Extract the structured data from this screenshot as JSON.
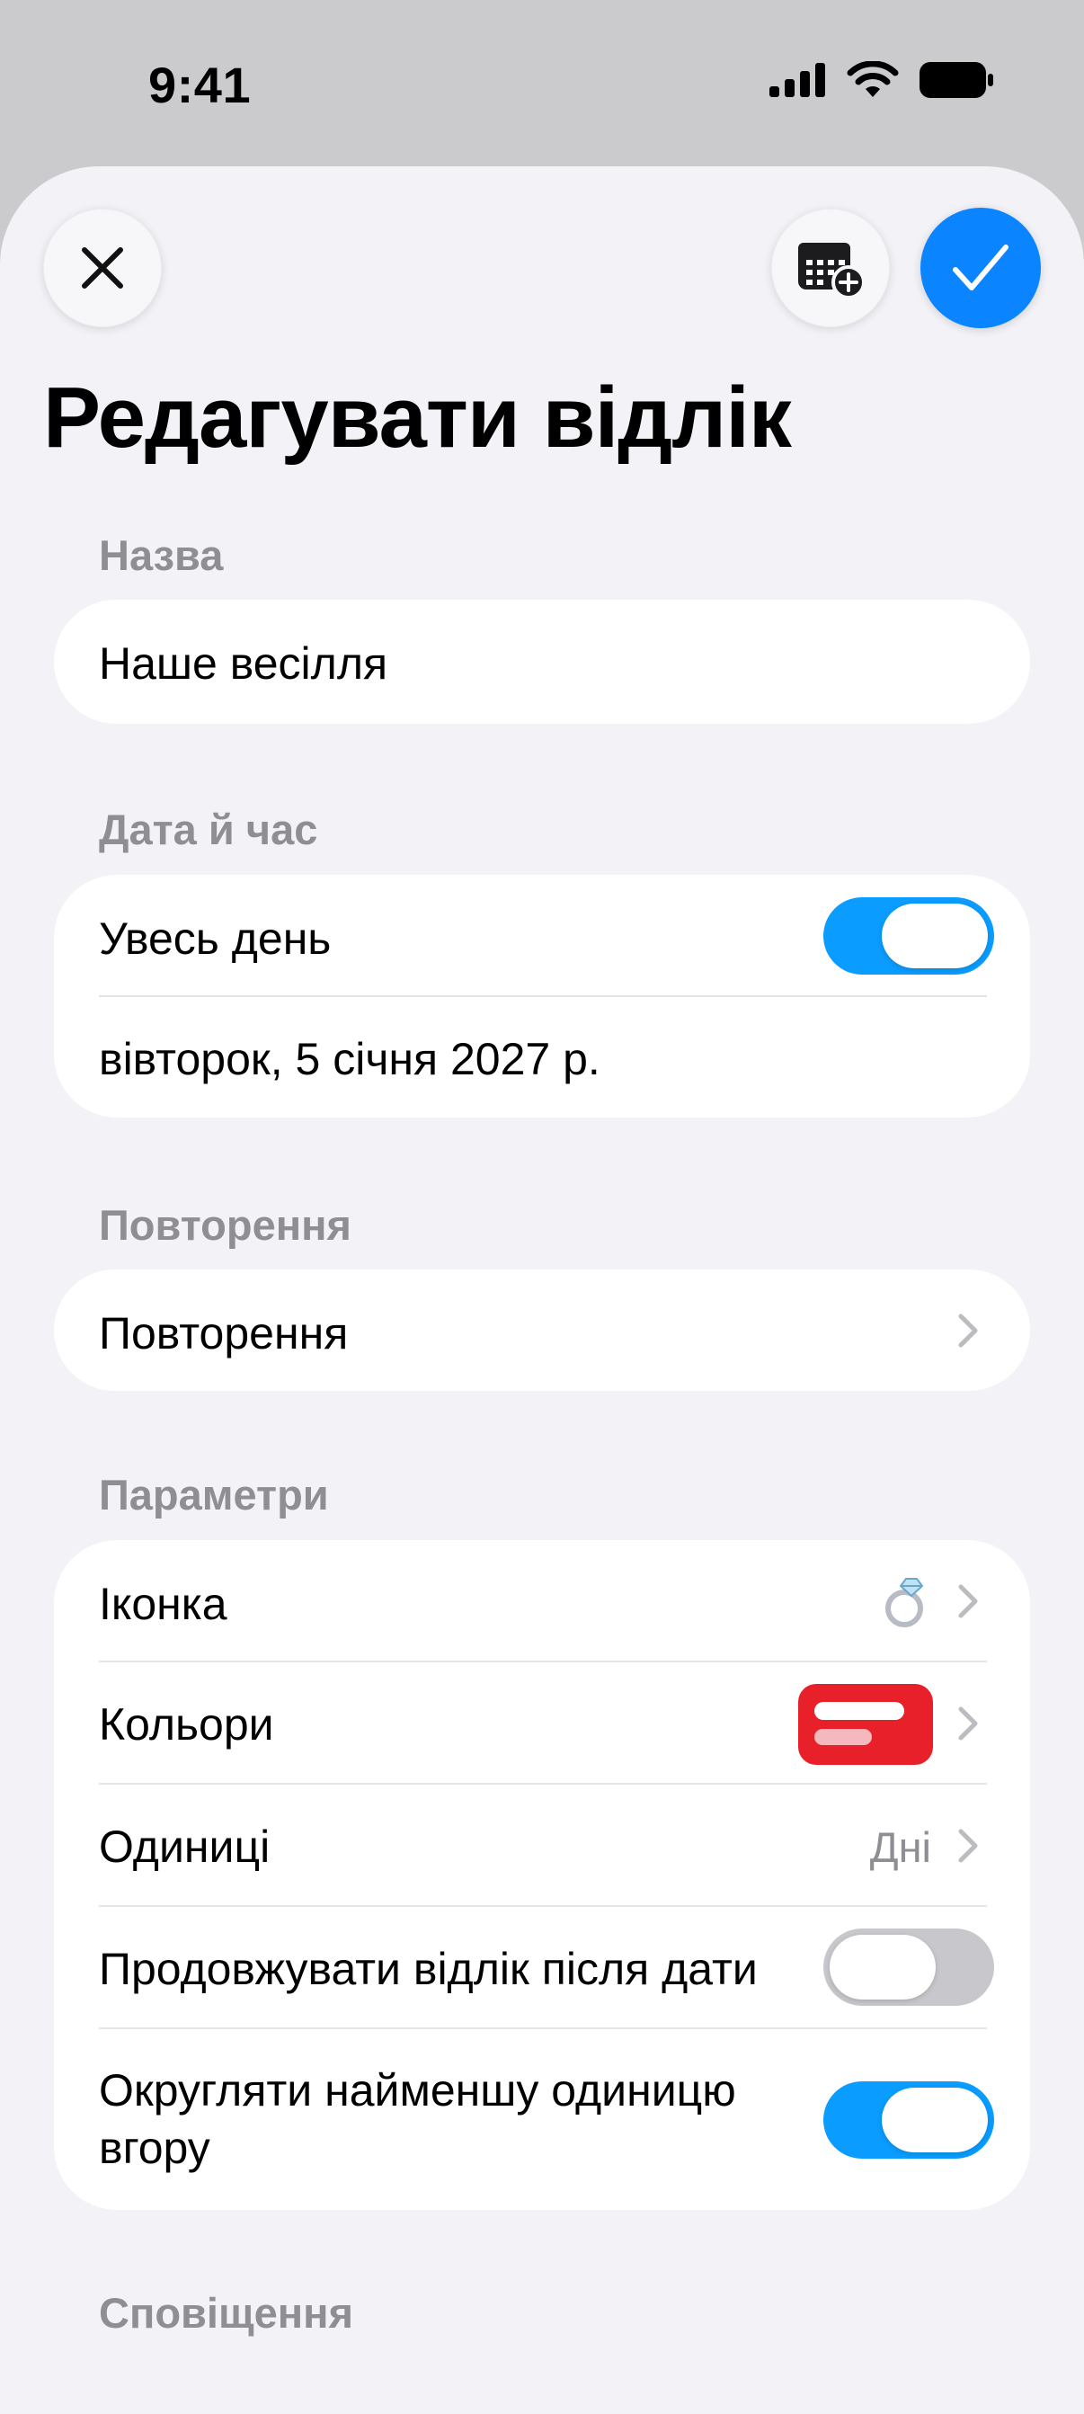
{
  "status_bar": {
    "time": "9:41"
  },
  "header": {
    "title": "Редагувати відлік",
    "close_icon": "close-icon",
    "calendar_icon": "calendar-add-icon",
    "confirm_icon": "checkmark-icon"
  },
  "sections": {
    "name": {
      "label": "Назва",
      "value": "Наше весілля"
    },
    "datetime": {
      "label": "Дата й час",
      "all_day_label": "Увесь день",
      "all_day_on": true,
      "date": "вівторок, 5 січня 2027 р."
    },
    "repeat": {
      "label": "Повторення",
      "row_label": "Повторення"
    },
    "params": {
      "label": "Параметри",
      "icon_label": "Іконка",
      "icon_value": "💍",
      "colors_label": "Кольори",
      "color_swatch": "#e8202a",
      "units_label": "Одиниці",
      "units_value": "Дні",
      "continue_label": "Продовжувати відлік після дати",
      "continue_on": false,
      "round_label_line1": "Округляти найменшу одиницю",
      "round_label_line2": "вгору",
      "round_on": true
    },
    "notifications": {
      "label": "Сповіщення"
    }
  },
  "colors": {
    "accent": "#0a84ff",
    "toggle_on": "#0a9cff",
    "secondary_text": "#8e8e93"
  }
}
